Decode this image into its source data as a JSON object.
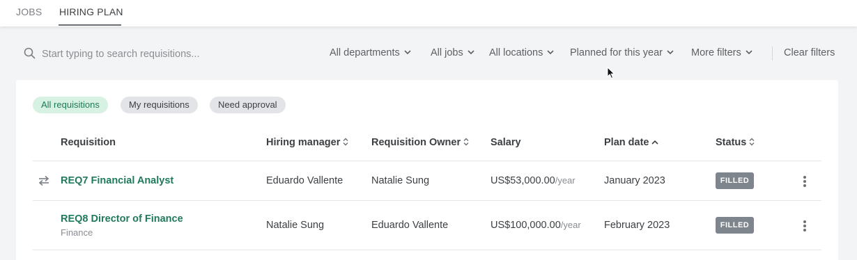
{
  "tabs": [
    {
      "label": "JOBS",
      "active": false
    },
    {
      "label": "HIRING PLAN",
      "active": true
    }
  ],
  "search": {
    "placeholder": "Start typing to search requisitions...",
    "value": ""
  },
  "filters": {
    "departments": "All departments",
    "jobs": "All jobs",
    "locations": "All locations",
    "plan": "Planned for this year",
    "more": "More filters",
    "clear": "Clear filters"
  },
  "chips": [
    "All requisitions",
    "My requisitions",
    "Need approval"
  ],
  "table": {
    "headers": {
      "requisition": "Requisition",
      "hiring_manager": "Hiring manager",
      "owner": "Requisition Owner",
      "salary": "Salary",
      "plan_date": "Plan date",
      "status": "Status"
    },
    "sort": {
      "column": "plan_date",
      "direction": "ascending"
    },
    "rows": [
      {
        "requisition": "REQ7 Financial Analyst",
        "department": "",
        "hiring_manager": "Eduardo Vallente",
        "owner": "Natalie Sung",
        "salary": "US$53,000.00",
        "salary_period": "/year",
        "plan_date": "January 2023",
        "status": "FILLED",
        "icon": "transfer-arrows-icon"
      },
      {
        "requisition": "REQ8 Director of Finance",
        "department": "Finance",
        "hiring_manager": "Natalie Sung",
        "owner": "Eduardo Vallente",
        "salary": "US$100,000.00",
        "salary_period": "/year",
        "plan_date": "February 2023",
        "status": "FILLED"
      }
    ]
  },
  "colors": {
    "accent_link": "#1f7a5c",
    "chip_active_bg": "#d7f1e2",
    "badge_bg": "#7f858c",
    "page_bg": "#f3f4f5"
  }
}
